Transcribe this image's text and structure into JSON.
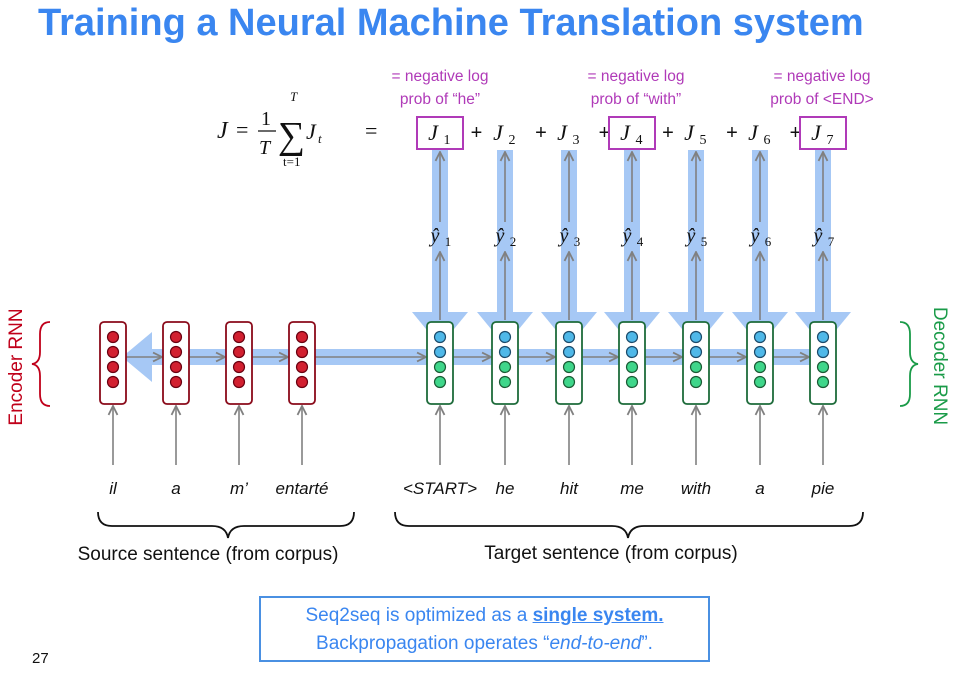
{
  "title": "Training a Neural Machine Translation system",
  "formula": {
    "lhs": "J",
    "equals": "=",
    "frac_num": "1",
    "frac_den": "T",
    "sum_top": "T",
    "sum_bottom": "t=1",
    "sum_sign": "∑",
    "term": "J",
    "term_sub": "t",
    "equals2": "="
  },
  "losses": [
    {
      "sub": "1",
      "boxed": true
    },
    {
      "sub": "2",
      "boxed": false
    },
    {
      "sub": "3",
      "boxed": false
    },
    {
      "sub": "4",
      "boxed": true
    },
    {
      "sub": "5",
      "boxed": false
    },
    {
      "sub": "6",
      "boxed": false
    },
    {
      "sub": "7",
      "boxed": true
    }
  ],
  "loss_plus": "+",
  "annotations": [
    {
      "line1": "= negative log",
      "line2": "prob of “he”"
    },
    {
      "line1": "= negative log",
      "line2": "prob of “with”"
    },
    {
      "line1": "= negative log",
      "line2": "prob of <END>"
    }
  ],
  "yhat_subs": [
    "1",
    "2",
    "3",
    "4",
    "5",
    "6",
    "7"
  ],
  "encoder_label": "Encoder RNN",
  "decoder_label": "Decoder RNN",
  "source_words": [
    "il",
    "a",
    "m’",
    "entarté"
  ],
  "target_words": [
    "<START>",
    "he",
    "hit",
    "me",
    "with",
    "a",
    "pie"
  ],
  "source_caption": "Source sentence (from corpus)",
  "target_caption": "Target sentence (from corpus)",
  "callout": {
    "line1_pre": "Seq2seq is optimized as a ",
    "line1_bold": "single system.",
    "line2_pre": "Backpropagation operates “",
    "line2_italic": "end-to-end",
    "line2_post": "”."
  },
  "page_number": "27",
  "colors": {
    "title": "#3a86f0",
    "encoder": "#c0001a",
    "decoder": "#1a9b48",
    "annotation": "#b03ab8",
    "backprop_arrow": "#a6c8f5",
    "callout_border": "#4a90e2",
    "arrow_gray": "#808080"
  }
}
